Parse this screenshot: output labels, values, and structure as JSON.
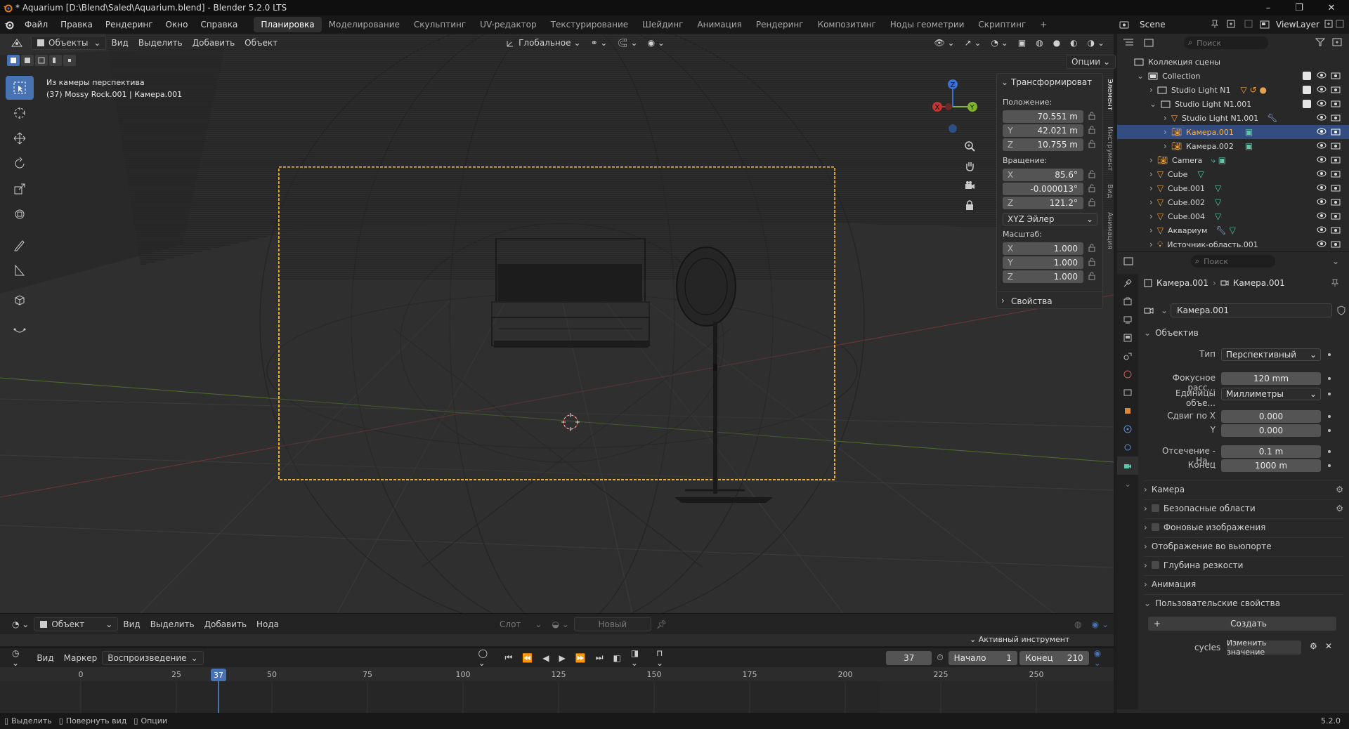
{
  "window": {
    "title": "* Aquarium [D:\\Blend\\Saled\\Aquarium.blend] - Blender 5.2.0 LTS"
  },
  "menu": [
    "Файл",
    "Правка",
    "Рендеринг",
    "Окно",
    "Справка"
  ],
  "workspaces": [
    "Планировка",
    "Моделирование",
    "Скульптинг",
    "UV-редактор",
    "Текстурирование",
    "Шейдинг",
    "Анимация",
    "Рендеринг",
    "Композитинг",
    "Ноды геометрии",
    "Скриптинг"
  ],
  "active_workspace": "Планировка",
  "scene": {
    "name": "Scene",
    "view_layer": "ViewLayer"
  },
  "viewport_header": {
    "mode": "Объекты",
    "menus": [
      "Вид",
      "Выделить",
      "Добавить",
      "Объект"
    ],
    "orientation": "Глобальное",
    "options": "Опции"
  },
  "viewport_info": {
    "line1": "Из камеры перспектива",
    "line2": "(37) Mossy Rock.001 | Камера.001"
  },
  "npanel": {
    "transform_title": "Трансформироват",
    "location_label": "Положение:",
    "location": [
      {
        "axis": "",
        "value": "70.551 m"
      },
      {
        "axis": "Y",
        "value": "42.021 m"
      },
      {
        "axis": "Z",
        "value": "10.755 m"
      }
    ],
    "rotation_label": "Вращение:",
    "rotation": [
      {
        "axis": "X",
        "value": "85.6°"
      },
      {
        "axis": "",
        "value": "-0.000013°"
      },
      {
        "axis": "Z",
        "value": "121.2°"
      }
    ],
    "rotation_mode": "XYZ Эйлер",
    "scale_label": "Масштаб:",
    "scale": [
      {
        "axis": "X",
        "value": "1.000"
      },
      {
        "axis": "Y",
        "value": "1.000"
      },
      {
        "axis": "Z",
        "value": "1.000"
      }
    ],
    "properties_title": "Свойства",
    "tabs": [
      "Элемент",
      "Инструмент",
      "Вид",
      "Анимация"
    ]
  },
  "outliner": {
    "search_placeholder": "Поиск",
    "root": "Коллекция сцены",
    "items": [
      {
        "name": "Collection",
        "depth": 1
      },
      {
        "name": "Studio Light N1",
        "depth": 2
      },
      {
        "name": "Studio Light N1.001",
        "depth": 2
      },
      {
        "name": "Studio Light N1.001",
        "depth": 3
      },
      {
        "name": "Камера.001",
        "depth": 3
      },
      {
        "name": "Камера.002",
        "depth": 3
      },
      {
        "name": "Camera",
        "depth": 2
      },
      {
        "name": "Cube",
        "depth": 2
      },
      {
        "name": "Cube.001",
        "depth": 2
      },
      {
        "name": "Cube.002",
        "depth": 2
      },
      {
        "name": "Cube.004",
        "depth": 2
      },
      {
        "name": "Аквариум",
        "depth": 2
      },
      {
        "name": "Источник-область.001",
        "depth": 2
      }
    ]
  },
  "properties": {
    "search_placeholder": "Поиск",
    "breadcrumb": [
      "Камера.001",
      "Камера.001"
    ],
    "datablock": "Камера.001",
    "lens_section": "Объектив",
    "type_label": "Тип",
    "type_value": "Перспективный",
    "focal_label": "Фокусное расс...",
    "focal_value": "120 mm",
    "units_label": "Единицы объе...",
    "units_value": "Миллиметры",
    "shift_x_label": "Сдвиг по X",
    "shift_x": "0.000",
    "shift_y_label": "Y",
    "shift_y": "0.000",
    "clip_start_label": "Отсечение - На...",
    "clip_start": "0.1 m",
    "clip_end_label": "Конец",
    "clip_end": "1000 m",
    "sections": [
      "Камера",
      "Безопасные области",
      "Фоновые изображения",
      "Отображение во вьюпорте",
      "Глубина резкости",
      "Анимация",
      "Пользовательские свойства"
    ],
    "create_button": "Создать",
    "custom_prop_name": "cycles",
    "edit_value_button": "Изменить значение"
  },
  "node_header": {
    "type": "Объект",
    "menus": [
      "Вид",
      "Выделить",
      "Добавить",
      "Нода"
    ],
    "slot": "Слот",
    "new": "Новый"
  },
  "active_tool_label": "Активный инструмент",
  "timeline": {
    "menus": [
      "Вид",
      "Маркер"
    ],
    "playback": "Воспроизведение",
    "current_frame": "37",
    "start_label": "Начало",
    "start": "1",
    "end_label": "Конец",
    "end": "210",
    "ticks": [
      "0",
      "25",
      "50",
      "75",
      "100",
      "125",
      "150",
      "175",
      "200",
      "225",
      "250"
    ]
  },
  "status": {
    "select": "Выделить",
    "rotate": "Повернуть вид",
    "options": "Опции",
    "version": "5.2.0"
  }
}
